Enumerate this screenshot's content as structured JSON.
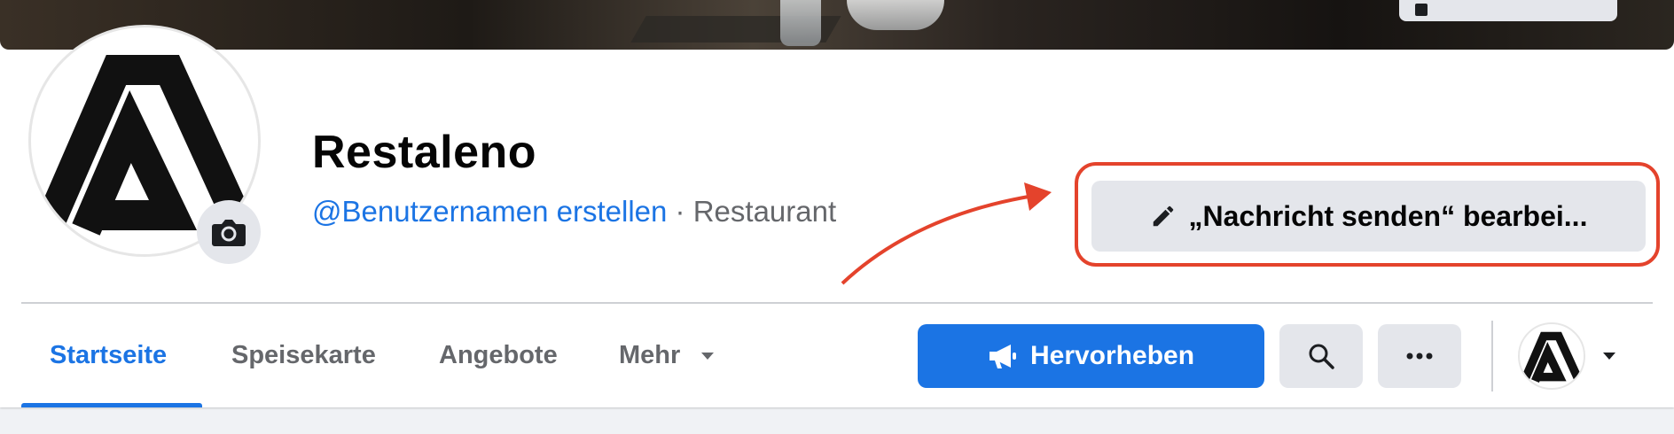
{
  "page": {
    "name": "Restaleno",
    "username": "@Benutzernamen erstellen",
    "separator": " · ",
    "category": "Restaurant"
  },
  "actions": {
    "edit_button_label": "„Nachricht senden“ bearbei..."
  },
  "tabs": [
    {
      "label": "Startseite",
      "active": true
    },
    {
      "label": "Speisekarte",
      "active": false
    },
    {
      "label": "Angebote",
      "active": false
    },
    {
      "label": "Mehr",
      "active": false
    }
  ],
  "toolbar": {
    "promote_label": "Hervorheben"
  },
  "icons": {
    "camera": "camera-icon",
    "pencil": "pencil-icon",
    "megaphone": "megaphone-icon",
    "search": "search-icon",
    "more": "more-horizontal-icon",
    "caret": "caret-down-icon"
  },
  "colors": {
    "accent": "#1b74e4",
    "annotation": "#e4432c",
    "button_grey": "#e4e6eb",
    "text_primary": "#050505",
    "text_secondary": "#65676b"
  }
}
